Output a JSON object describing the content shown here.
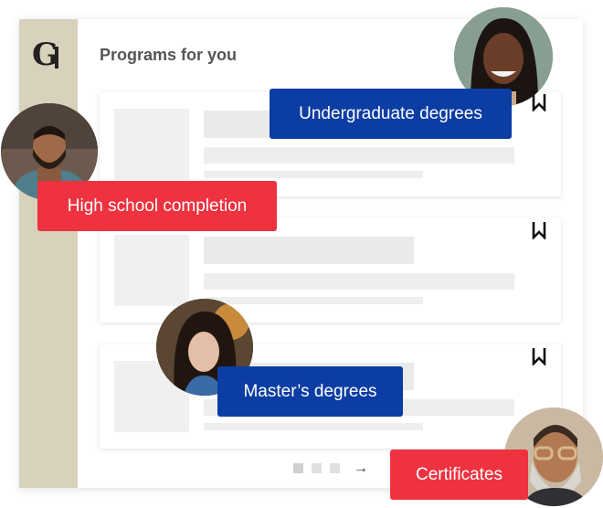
{
  "page": {
    "title": "Programs for you"
  },
  "logo": {
    "letters": "G"
  },
  "programs": [
    {
      "id": 1
    },
    {
      "id": 2
    },
    {
      "id": 3
    }
  ],
  "pills": {
    "undergraduate": "Undergraduate degrees",
    "high_school": "High school completion",
    "masters": "Master’s degrees",
    "certificates": "Certificates"
  },
  "pagination": {
    "next_arrow": "→"
  },
  "icons": {
    "logo": "monogram-logo",
    "bookmark": "bookmark-icon",
    "next": "arrow-right-icon"
  },
  "colors": {
    "sidebar": "#d8d1bc",
    "blue_pill": "#0c3da3",
    "red_pill": "#ef3240"
  }
}
